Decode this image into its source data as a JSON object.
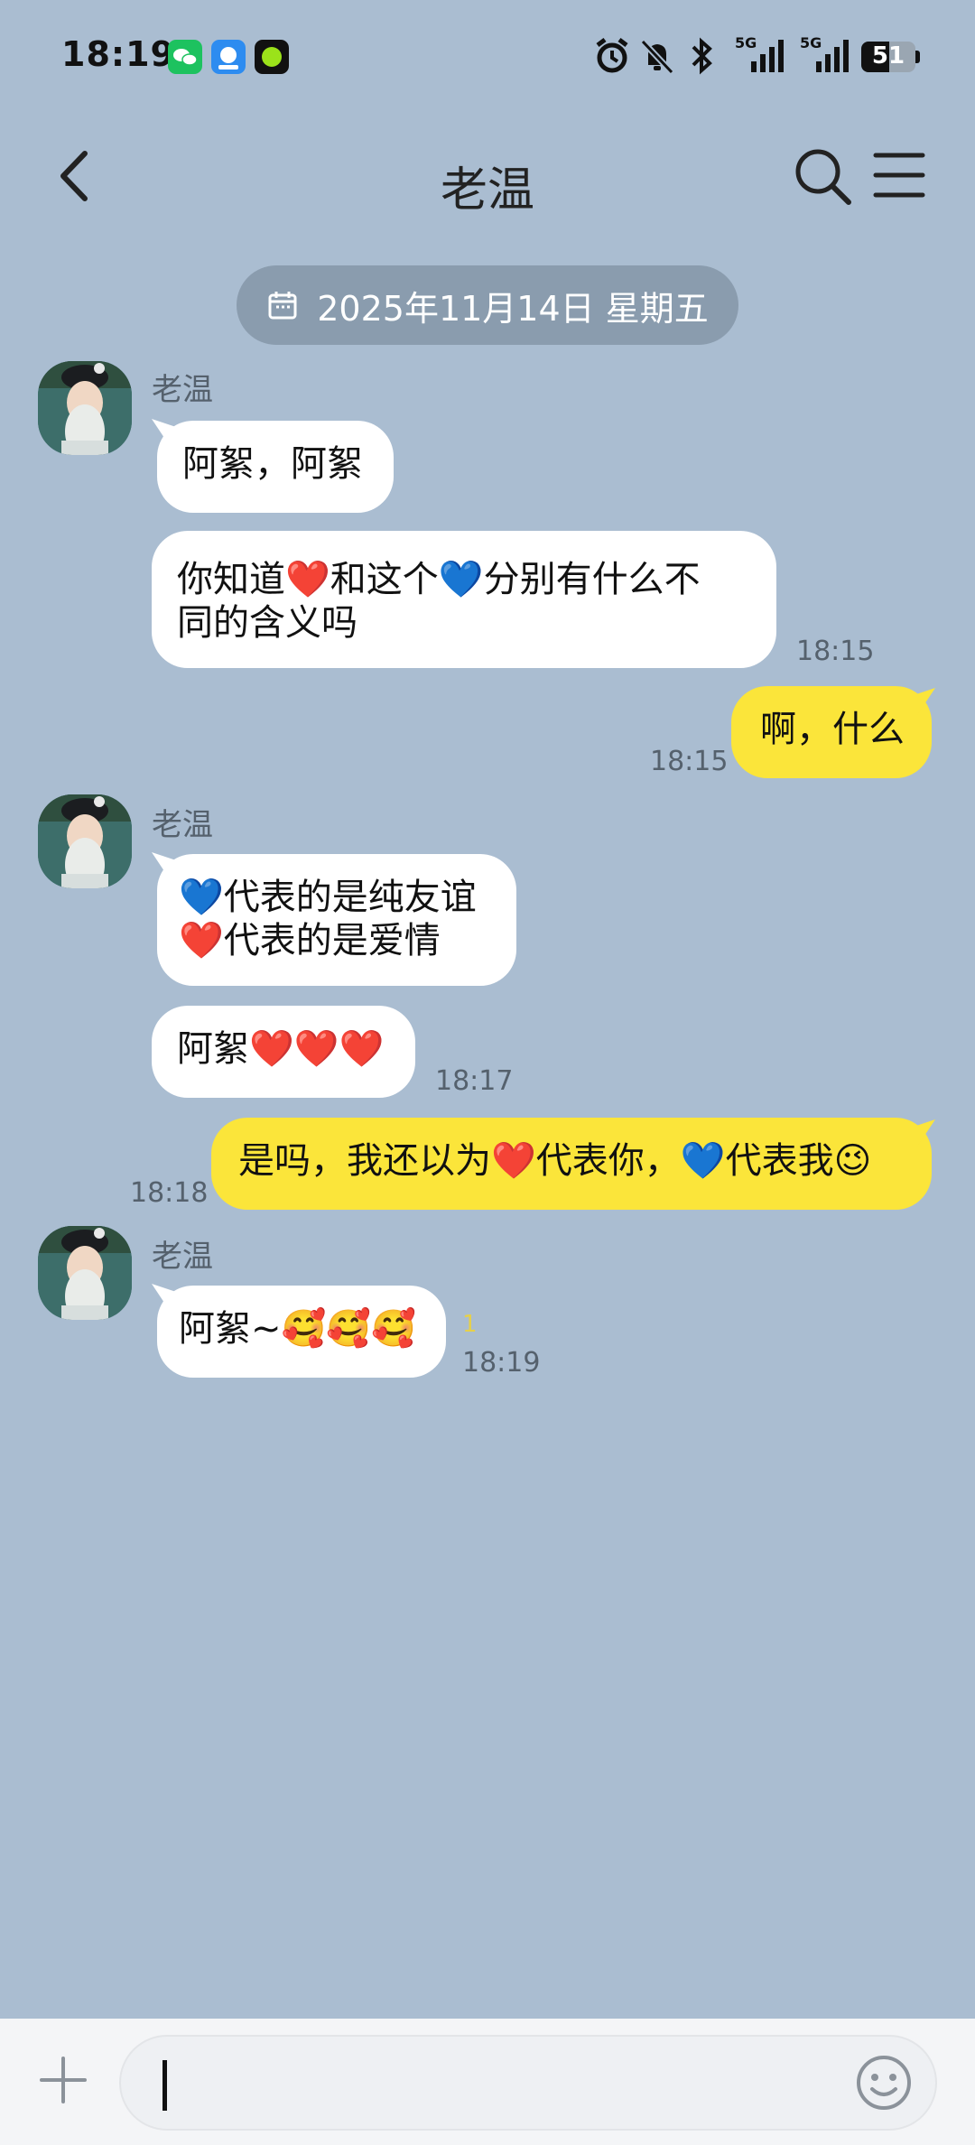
{
  "status_bar": {
    "time": "18:19",
    "battery": "51",
    "network1": "5G",
    "network2": "5G"
  },
  "header": {
    "title": "老温"
  },
  "date_chip": {
    "text": "2025年11月14日 星期五"
  },
  "messages": [
    {
      "sender": "老温",
      "text": "阿絮，阿絮"
    },
    {
      "text": "你知道❤️和这个💙分别有什么不\n同的含义吗",
      "time": "18:15"
    },
    {
      "text": "啊，什么",
      "time": "18:15"
    },
    {
      "sender": "老温",
      "text": "💙代表的是纯友谊\n❤️代表的是爱情"
    },
    {
      "text": "阿絮❤️❤️❤️",
      "time": "18:17"
    },
    {
      "text": "是吗，我还以为❤️代表你，💙代表我😉",
      "time": "18:18"
    },
    {
      "sender": "老温",
      "text": "阿絮~🥰🥰🥰",
      "unread": "1",
      "time": "18:19"
    }
  ],
  "colors": {
    "background": "#aabdd1",
    "incoming_bubble": "#ffffff",
    "outgoing_bubble": "#fbe53a",
    "date_chip": "#8a9cae"
  }
}
